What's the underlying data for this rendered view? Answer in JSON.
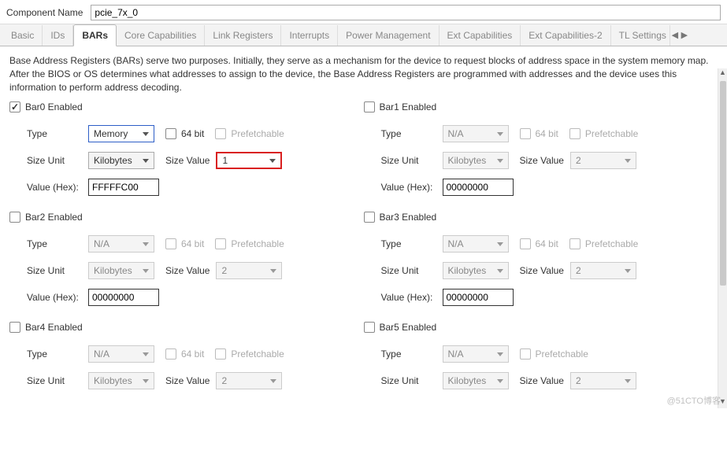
{
  "componentName": {
    "label": "Component Name",
    "value": "pcie_7x_0"
  },
  "tabs": {
    "items": [
      {
        "label": "Basic"
      },
      {
        "label": "IDs"
      },
      {
        "label": "BARs"
      },
      {
        "label": "Core Capabilities"
      },
      {
        "label": "Link Registers"
      },
      {
        "label": "Interrupts"
      },
      {
        "label": "Power Management"
      },
      {
        "label": "Ext Capabilities"
      },
      {
        "label": "Ext Capabilities-2"
      },
      {
        "label": "TL Settings"
      }
    ],
    "activeIndex": 2
  },
  "description": "Base Address Registers (BARs) serve two purposes. Initially, they serve as a mechanism for the device to request blocks of address space in the system memory map. After the BIOS or OS determines what addresses to assign to the device, the Base Address Registers are programmed with addresses and the device uses this information to perform address decoding.",
  "fieldLabels": {
    "type": "Type",
    "sizeUnit": "Size Unit",
    "sizeValue": "Size Value",
    "valueHex": "Value (Hex):",
    "sixtyFour": "64 bit",
    "prefetch": "Prefetchable"
  },
  "bars": [
    {
      "title": "Bar0 Enabled",
      "enabled": true,
      "type": "Memory",
      "typeHighlight": "blue",
      "sixtyFourEnabled": true,
      "sixtyFour": false,
      "prefetchEnabled": false,
      "sizeUnit": "Kilobytes",
      "sizeValue": "1",
      "sizeValueHighlight": "red",
      "valueHex": "FFFFFC00",
      "showHex": true
    },
    {
      "title": "Bar1 Enabled",
      "enabled": false,
      "type": "N/A",
      "sixtyFourEnabled": false,
      "prefetchEnabled": false,
      "sizeUnit": "Kilobytes",
      "sizeValue": "2",
      "valueHex": "00000000",
      "showHex": true
    },
    {
      "title": "Bar2 Enabled",
      "enabled": false,
      "type": "N/A",
      "sixtyFourEnabled": false,
      "prefetchEnabled": false,
      "sizeUnit": "Kilobytes",
      "sizeValue": "2",
      "valueHex": "00000000",
      "showHex": true
    },
    {
      "title": "Bar3 Enabled",
      "enabled": false,
      "type": "N/A",
      "sixtyFourEnabled": false,
      "prefetchEnabled": false,
      "sizeUnit": "Kilobytes",
      "sizeValue": "2",
      "valueHex": "00000000",
      "showHex": true
    },
    {
      "title": "Bar4 Enabled",
      "enabled": false,
      "type": "N/A",
      "sixtyFourEnabled": false,
      "prefetchEnabled": false,
      "sizeUnit": "Kilobytes",
      "sizeValue": "2",
      "showHex": false
    },
    {
      "title": "Bar5 Enabled",
      "enabled": false,
      "type": "N/A",
      "sixtyFourEnabled": false,
      "hideSixtyFour": true,
      "prefetchEnabled": false,
      "sizeUnit": "Kilobytes",
      "sizeValue": "2",
      "showHex": false
    }
  ],
  "watermark": "@51CTO博客"
}
